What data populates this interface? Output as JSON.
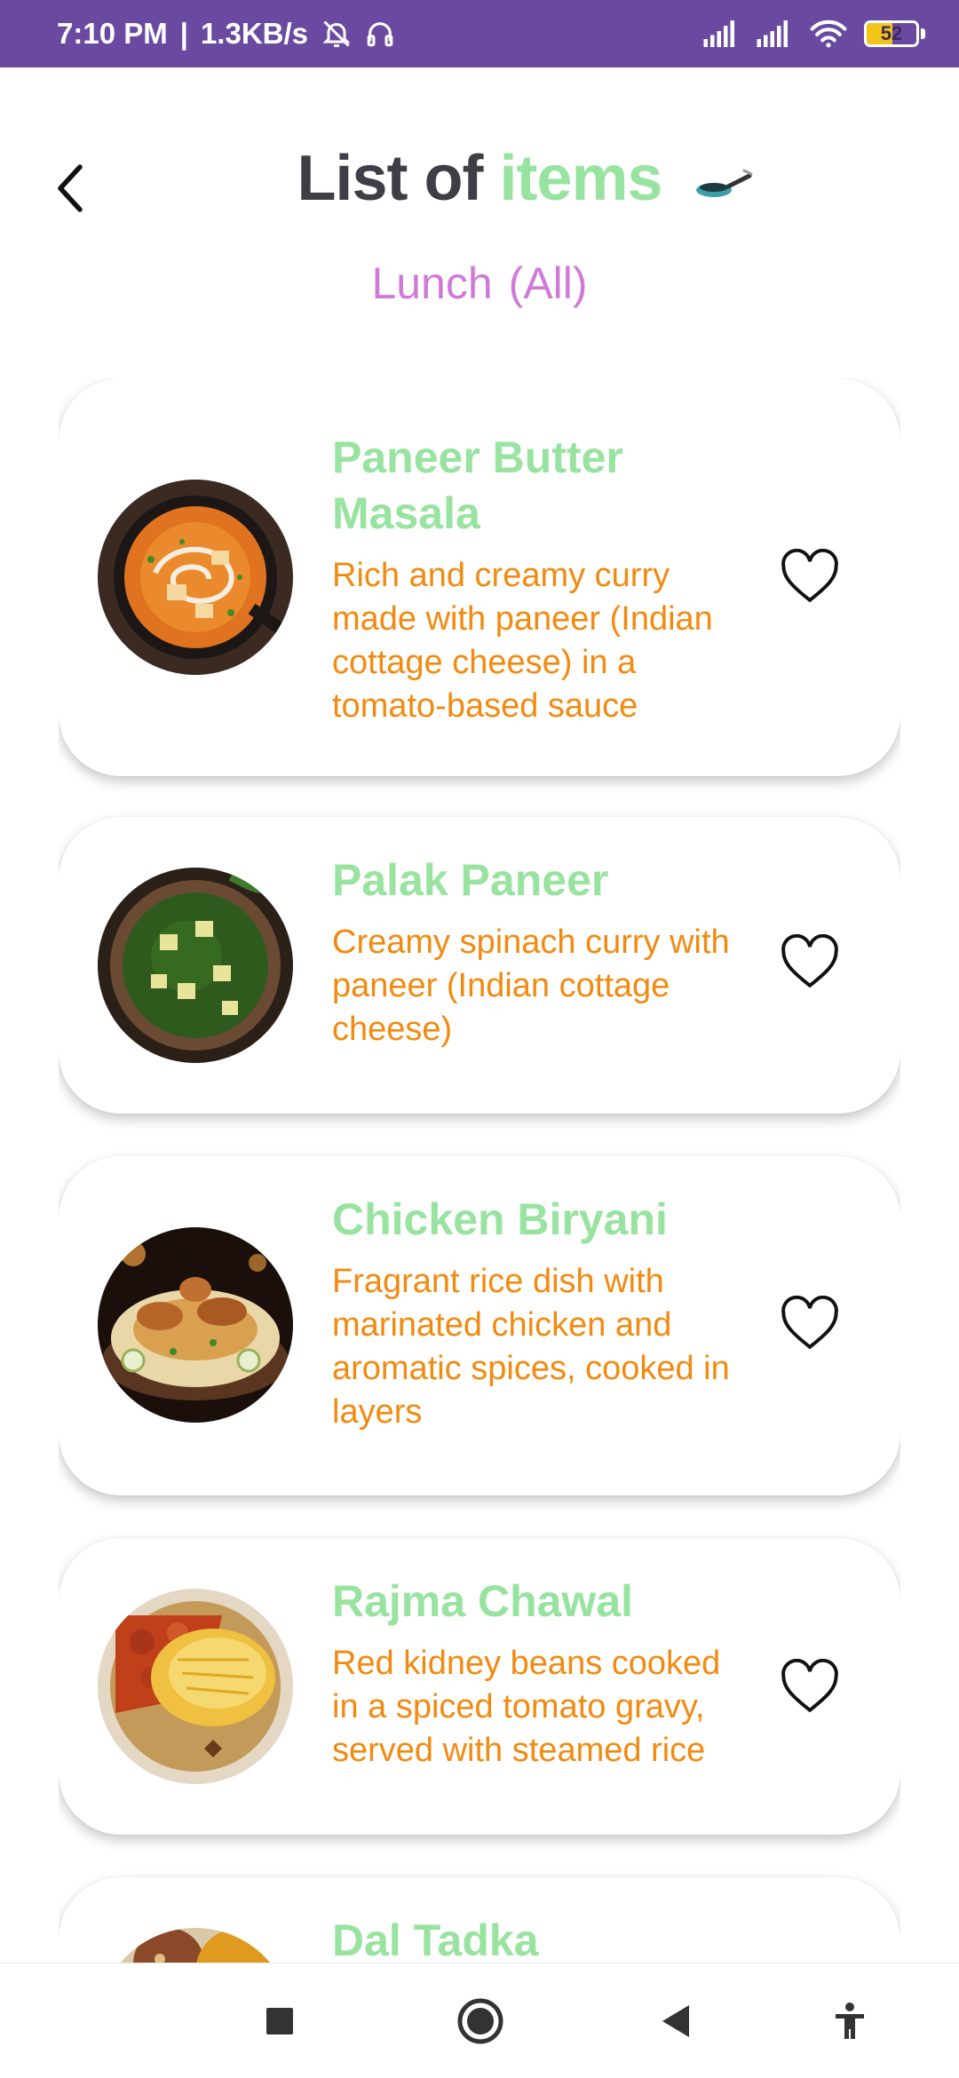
{
  "status_bar": {
    "time": "7:10 PM",
    "separator": "|",
    "speed": "1.3KB/s",
    "battery_level": "52",
    "icons": [
      "notifications-off-icon",
      "headset-icon",
      "signal-icon",
      "signal-icon",
      "wifi-icon",
      "battery-icon"
    ]
  },
  "header": {
    "back_icon": "chevron-left-icon",
    "title_part1": "List of",
    "title_part2": "items",
    "title_icon": "frying-pan-icon",
    "subtitle_meal": "Lunch",
    "subtitle_filter": "(All)"
  },
  "items": [
    {
      "title": "Paneer Butter Masala",
      "description": "Rich and creamy curry made with paneer (Indian cottage cheese) in a tomato-based sauce",
      "favorite_icon": "heart-outline-icon"
    },
    {
      "title": "Palak Paneer",
      "description": "Creamy spinach curry with paneer (Indian cottage cheese)",
      "favorite_icon": "heart-outline-icon"
    },
    {
      "title": "Chicken Biryani",
      "description": "Fragrant rice dish with marinated chicken and aromatic spices, cooked in layers",
      "favorite_icon": "heart-outline-icon"
    },
    {
      "title": "Rajma Chawal",
      "description": "Red kidney beans cooked in a spiced tomato gravy, served with steamed rice",
      "favorite_icon": "heart-outline-icon"
    },
    {
      "title": "Dal Tadka",
      "description": "",
      "favorite_icon": "heart-outline-icon"
    }
  ],
  "nav_bar": {
    "icons": [
      "recents-square-icon",
      "home-circle-icon",
      "back-triangle-icon",
      "accessibility-icon"
    ]
  },
  "colors": {
    "status_bar": "#6a4aa0",
    "title_dark": "#3f3e47",
    "title_accent": "#98e3a0",
    "subtitle": "#d07ad8",
    "description": "#f28a10"
  }
}
